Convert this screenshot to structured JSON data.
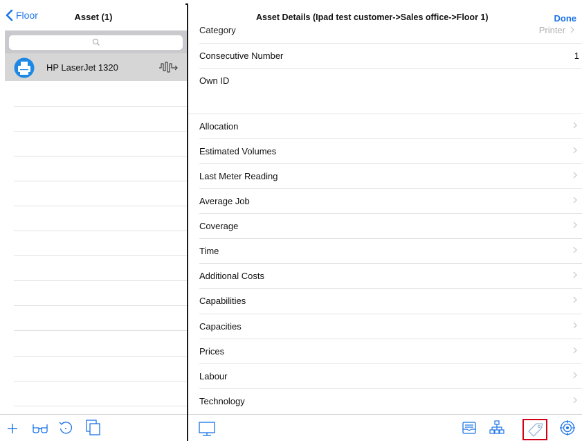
{
  "left": {
    "back_label": "Floor",
    "title": "Asset (1)",
    "asset": {
      "name": "HP LaserJet 1320"
    }
  },
  "right": {
    "title": "Asset Details (Ipad test customer->Sales office->Floor 1)",
    "done_label": "Done",
    "category": {
      "label": "Category",
      "value": "Printer"
    },
    "fields": [
      {
        "label": "Consecutive Number",
        "value": "1"
      },
      {
        "label": "Own ID",
        "value": ""
      }
    ],
    "sections": [
      "Allocation",
      "Estimated Volumes",
      "Last Meter Reading",
      "Average Job",
      "Coverage",
      "Time",
      "Additional Costs",
      "Capabilities",
      "Capacities",
      "Prices",
      "Labour",
      "Technology"
    ]
  },
  "toolbar": {
    "left_icons": [
      "plus-icon",
      "glasses-icon",
      "refresh-icon",
      "copy-icon"
    ],
    "right_icons": [
      "monitor-icon",
      "inbox-icon",
      "hierarchy-icon",
      "tag-icon",
      "target-icon"
    ],
    "highlight_color": "#d0021b"
  },
  "colors": {
    "accent": "#1a73e8",
    "selected_row": "#d6d6d6",
    "search_bar_bg": "#c9c9ce"
  }
}
